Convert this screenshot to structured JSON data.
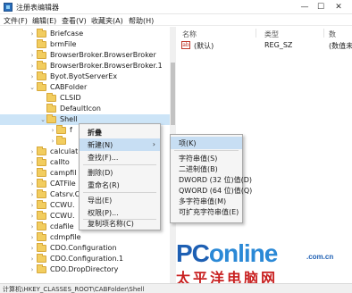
{
  "window": {
    "title": "注册表编辑器",
    "controls": {
      "minimize": "—",
      "maximize": "☐",
      "close": "✕"
    }
  },
  "menubar": [
    "文件(F)",
    "编辑(E)",
    "查看(V)",
    "收藏夹(A)",
    "帮助(H)"
  ],
  "tree": {
    "items": [
      {
        "label": "Briefcase",
        "expander": "›"
      },
      {
        "label": "brmFile",
        "expander": ""
      },
      {
        "label": "BrowserBroker.BrowserBroker",
        "expander": "›"
      },
      {
        "label": "BrowserBroker.BrowserBroker.1",
        "expander": "›"
      },
      {
        "label": "Byot.ByotServerEx",
        "expander": "›"
      },
      {
        "label": "CABFolder",
        "expander": "⌄"
      },
      {
        "label": "CLSID",
        "expander": ""
      },
      {
        "label": "DefaultIcon",
        "expander": ""
      },
      {
        "label": "Shell",
        "expander": "⌄"
      },
      {
        "label": "f",
        "expander": "›"
      },
      {
        "label": "",
        "expander": "›"
      },
      {
        "label": "calculat",
        "expander": "›"
      },
      {
        "label": "callto",
        "expander": "›"
      },
      {
        "label": "campfil",
        "expander": "›"
      },
      {
        "label": "CATFile",
        "expander": "›"
      },
      {
        "label": "Catsrv.C",
        "expander": "›"
      },
      {
        "label": "CCWU.",
        "expander": "›"
      },
      {
        "label": "CCWU.",
        "expander": "›"
      },
      {
        "label": "cdafile",
        "expander": "›"
      },
      {
        "label": "cdmpfile",
        "expander": "›"
      },
      {
        "label": "CDO.Configuration",
        "expander": "›"
      },
      {
        "label": "CDO.Configuration.1",
        "expander": "›"
      },
      {
        "label": "CDO.DropDirectory",
        "expander": "›"
      }
    ]
  },
  "list": {
    "columns": [
      "名称",
      "类型",
      "数"
    ],
    "rows": [
      {
        "icon": "ab",
        "name": "(默认)",
        "type": "REG_SZ",
        "data": "(数值未"
      }
    ]
  },
  "context_menu": {
    "items": [
      "折叠",
      "新建(N)",
      "查找(F)...",
      "删除(D)",
      "重命名(R)",
      "导出(E)",
      "权限(P)...",
      "复制项名称(C)"
    ],
    "submenu_arrow": "›"
  },
  "submenu": {
    "items": [
      "项(K)",
      "字符串值(S)",
      "二进制值(B)",
      "DWORD (32 位)值(D)",
      "QWORD (64 位)值(Q)",
      "多字符串值(M)",
      "可扩充字符串值(E)"
    ]
  },
  "statusbar": {
    "path": "计算机\\HKEY_CLASSES_ROOT\\CABFolder\\Shell"
  },
  "watermark": {
    "logo_part1": "PC",
    "logo_part2": "online",
    "domain": ".com.cn",
    "chinese": "太平洋电脑网"
  },
  "colors": {
    "selection": "#cce4f7",
    "menu_highlight": "#c7def3",
    "folder": "#f2cd5f",
    "watermark_blue": "#1d5fb3",
    "watermark_red": "#c81f1f"
  }
}
